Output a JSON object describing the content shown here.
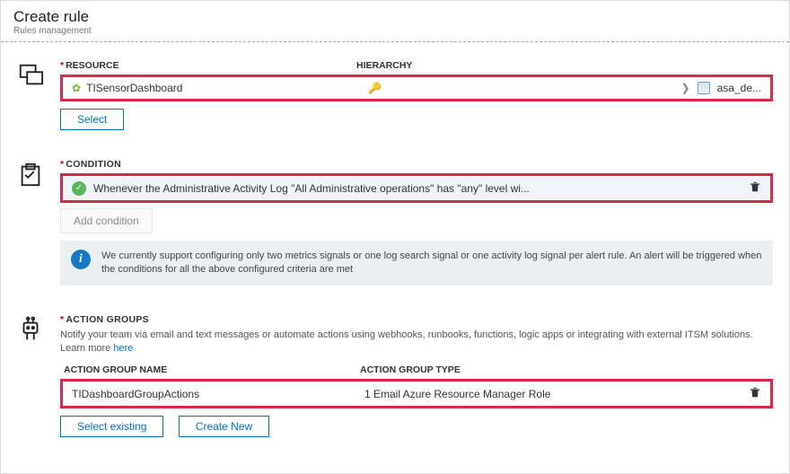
{
  "header": {
    "title": "Create rule",
    "subtitle": "Rules management"
  },
  "resource": {
    "section_label": "RESOURCE",
    "hierarchy_label": "HIERARCHY",
    "name": "TISensorDashboard",
    "target": "asa_de...",
    "select_btn": "Select"
  },
  "condition": {
    "section_label": "CONDITION",
    "text": "Whenever the Administrative Activity Log \"All Administrative operations\" has \"any\" level wi...",
    "add_btn": "Add condition",
    "info": "We currently support configuring only two metrics signals or one log search signal or one activity log signal per alert rule. An alert will be triggered when the conditions for all the above configured criteria are met"
  },
  "action_groups": {
    "section_label": "ACTION GROUPS",
    "desc_prefix": "Notify your team via email and text messages or automate actions using webhooks, runbooks, functions, logic apps or integrating with external ITSM solutions. Learn more ",
    "learn_more": "here",
    "col_name": "ACTION GROUP NAME",
    "col_type": "ACTION GROUP TYPE",
    "row_name": "TIDashboardGroupActions",
    "row_type": "1 Email Azure Resource Manager Role",
    "select_existing": "Select existing",
    "create_new": "Create New"
  }
}
